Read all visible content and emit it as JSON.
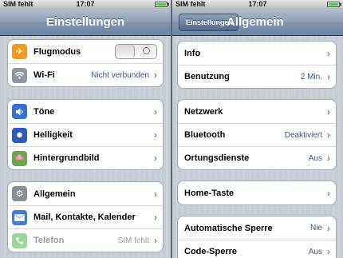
{
  "left": {
    "status": {
      "carrier": "SIM fehlt",
      "time": "17:07"
    },
    "nav_title": "Einstellungen",
    "groups": [
      [
        {
          "icon": "airplane-icon",
          "label": "Flugmodus",
          "toggle": true
        },
        {
          "icon": "wifi-icon",
          "label": "Wi-Fi",
          "value": "Nicht verbunden"
        }
      ],
      [
        {
          "icon": "speaker-icon",
          "label": "Töne"
        },
        {
          "icon": "brightness-icon",
          "label": "Helligkeit"
        },
        {
          "icon": "flower-icon",
          "label": "Hintergrundbild"
        }
      ],
      [
        {
          "icon": "gear-icon",
          "label": "Allgemein"
        },
        {
          "icon": "mail-icon",
          "label": "Mail, Kontakte, Kalender"
        },
        {
          "icon": "phone-icon",
          "label": "Telefon",
          "value": "SIM fehlt"
        }
      ]
    ]
  },
  "right": {
    "status": {
      "carrier": "SIM fehlt",
      "time": "17:07"
    },
    "back_label": "Einstellungen",
    "nav_title": "Allgemein",
    "groups": [
      [
        {
          "label": "Info"
        },
        {
          "label": "Benutzung",
          "value": "2 Min."
        }
      ],
      [
        {
          "label": "Netzwerk"
        },
        {
          "label": "Bluetooth",
          "value": "Deaktiviert"
        },
        {
          "label": "Ortungsdienste",
          "value": "Aus"
        }
      ],
      [
        {
          "label": "Home-Taste"
        }
      ],
      [
        {
          "label": "Automatische Sperre",
          "value": "Nie"
        },
        {
          "label": "Code-Sperre",
          "value": "Aus"
        }
      ]
    ]
  }
}
